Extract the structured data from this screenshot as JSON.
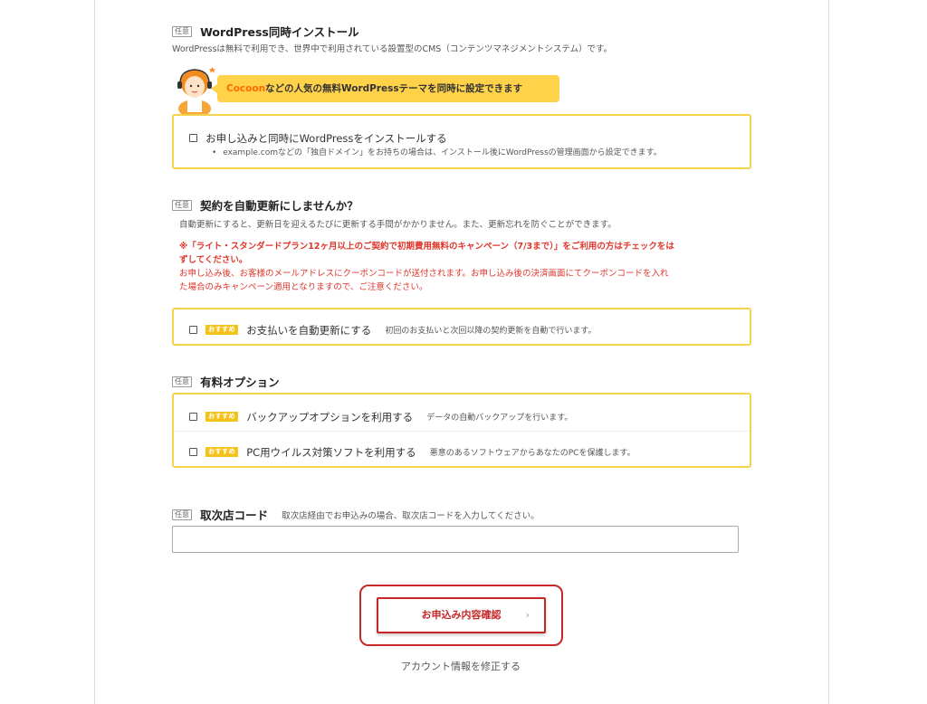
{
  "optional_tag": "任意",
  "wordpress": {
    "title": "WordPress同時インストール",
    "description": "WordPressは無料で利用でき、世界中で利用されている設置型のCMS（コンテンツマネジメントシステム）です。",
    "bubble_highlight": "Cocoon",
    "bubble_text": "などの人気の無料WordPressテーマを同時に設定できます",
    "checkbox_label": "お申し込みと同時にWordPressをインストールする",
    "note": "example.comなどの「独自ドメイン」をお持ちの場合は、インストール後にWordPressの管理画面から設定できます。"
  },
  "auto_renew": {
    "title": "契約を自動更新にしませんか？",
    "description": "自動更新にすると、更新日を迎えるたびに更新する手間がかかりません。また、更新忘れを防ぐことができます。",
    "warning_bold_line1": "※「ライト・スタンダードプラン12ヶ月以上のご契約で初期費用無料のキャンペーン（7/3まで）」をご利用の方はチェックをは",
    "warning_bold_line2": "ずしてください。",
    "warning_line3": "お申し込み後、お客様のメールアドレスにクーポンコードが送付されます。お申し込み後の決済画面にてクーポンコードを入れ",
    "warning_line4": "た場合のみキャンペーン適用となりますので、ご注意ください。",
    "recommend_badge": "おすすめ",
    "checkbox_label": "お支払いを自動更新にする",
    "checkbox_sub": "初回のお支払いと次回以降の契約更新を自動で行います。"
  },
  "paid_options": {
    "title": "有料オプション",
    "recommend_badge": "おすすめ",
    "items": [
      {
        "label": "バックアップオプションを利用する",
        "sub": "データの自動バックアップを行います。"
      },
      {
        "label": "PC用ウイルス対策ソフトを利用する",
        "sub": "悪意のあるソフトウェアからあなたのPCを保護します。"
      }
    ]
  },
  "agent_code": {
    "title": "取次店コード",
    "description": "取次店経由でお申込みの場合、取次店コードを入力してください。",
    "value": ""
  },
  "submit": {
    "label": "お申込み内容確認",
    "arrow": "›"
  },
  "edit_account_link": "アカウント情報を修正する",
  "colors": {
    "accent_yellow": "#f4d24a",
    "bubble_yellow": "#ffd24a",
    "warning_red": "#e0362b",
    "submit_red": "#c62828",
    "highlight_orange": "#ff6a00"
  }
}
